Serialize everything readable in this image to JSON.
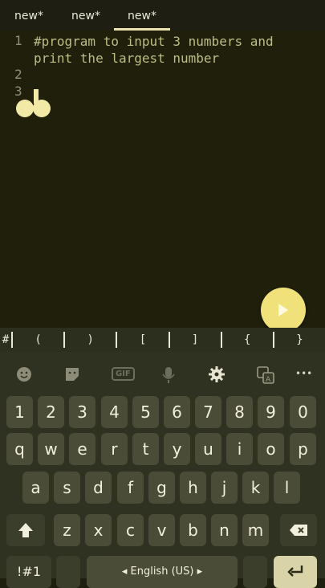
{
  "tabs": [
    "new*",
    "new*",
    "new*"
  ],
  "editor": {
    "line_numbers": [
      "1",
      "2",
      "3"
    ],
    "lines": [
      "#program to input 3 numbers and",
      "print the largest number"
    ]
  },
  "symbols": [
    "#",
    "(",
    ")",
    "[",
    "]",
    "{",
    "}"
  ],
  "keyboard": {
    "toolbar_icons": [
      "emoji-icon",
      "sticker-icon",
      "gif-icon",
      "mic-icon",
      "gear-icon",
      "translate-icon",
      "more-icon"
    ],
    "gif_label": "GIF",
    "more_label": "•••",
    "row_numbers": [
      "1",
      "2",
      "3",
      "4",
      "5",
      "6",
      "7",
      "8",
      "9",
      "0"
    ],
    "row1": [
      "q",
      "w",
      "e",
      "r",
      "t",
      "y",
      "u",
      "i",
      "o",
      "p"
    ],
    "row2": [
      "a",
      "s",
      "d",
      "f",
      "g",
      "h",
      "j",
      "k",
      "l"
    ],
    "row3": [
      "z",
      "x",
      "c",
      "v",
      "b",
      "n",
      "m"
    ],
    "symbols_key": "!#1",
    "space_label": "◂ English (US) ▸"
  }
}
